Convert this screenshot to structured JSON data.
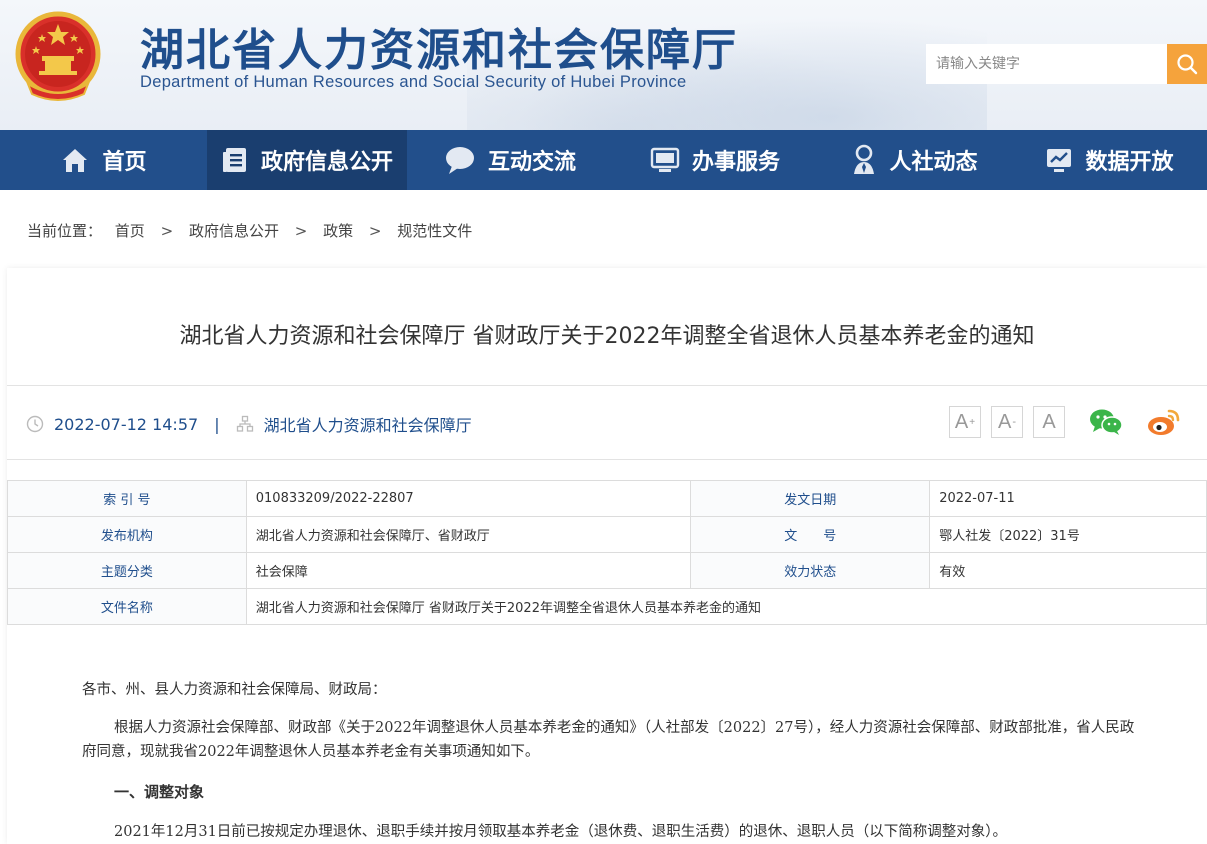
{
  "header": {
    "title": "湖北省人力资源和社会保障厅",
    "subtitle": "Department of Human Resources and Social Security of Hubei Province",
    "search_placeholder": "请输入关键字",
    "colors": {
      "brand": "#1f4e8c",
      "nav": "#224f8b",
      "nav_active": "#1a3e6f",
      "search_button": "#f5a33c"
    }
  },
  "nav": {
    "items": [
      {
        "label": "首页",
        "icon": "home-icon"
      },
      {
        "label": "政府信息公开",
        "icon": "document-list-icon",
        "active": true
      },
      {
        "label": "互动交流",
        "icon": "chat-bubble-icon"
      },
      {
        "label": "办事服务",
        "icon": "monitor-icon"
      },
      {
        "label": "人社动态",
        "icon": "person-icon"
      },
      {
        "label": "数据开放",
        "icon": "chart-trend-icon"
      }
    ]
  },
  "breadcrumb": {
    "prefix": "当前位置：",
    "items": [
      "首页",
      "政府信息公开",
      "政策",
      "规范性文件"
    ],
    "separator": ">"
  },
  "article": {
    "title": "湖北省人力资源和社会保障厅 省财政厅关于2022年调整全省退休人员基本养老金的通知",
    "datetime": "2022-07-12 14:57",
    "pipe": "|",
    "source": "湖北省人力资源和社会保障厅",
    "font_buttons": [
      "A",
      "A",
      "A"
    ],
    "font_marks": [
      "+",
      "-"
    ],
    "share_icons": [
      "wechat-icon",
      "weibo-icon"
    ]
  },
  "info_table": {
    "rows": [
      {
        "k1": "索 引 号",
        "v1": "010833209/2022-22807",
        "k2": "发文日期",
        "v2": "2022-07-11"
      },
      {
        "k1": "发布机构",
        "v1": "湖北省人力资源和社会保障厅、省财政厅",
        "k2": "文　　号",
        "v2": "鄂人社发〔2022〕31号"
      },
      {
        "k1": "主题分类",
        "v1": "社会保障",
        "k2": "效力状态",
        "v2": "有效"
      },
      {
        "k1": "文件名称",
        "v1": "湖北省人力资源和社会保障厅 省财政厅关于2022年调整全省退休人员基本养老金的通知"
      }
    ]
  },
  "content": {
    "greeting": "各市、州、县人力资源和社会保障局、财政局：",
    "para1": "根据人力资源社会保障部、财政部《关于2022年调整退休人员基本养老金的通知》（人社部发〔2022〕27号），经人力资源社会保障部、财政部批准，省人民政府同意，现就我省2022年调整退休人员基本养老金有关事项通知如下。",
    "heading1": "一、调整对象",
    "para2": "2021年12月31日前已按规定办理退休、退职手续并按月领取基本养老金（退休费、退职生活费）的退休、退职人员（以下简称调整对象）。"
  }
}
